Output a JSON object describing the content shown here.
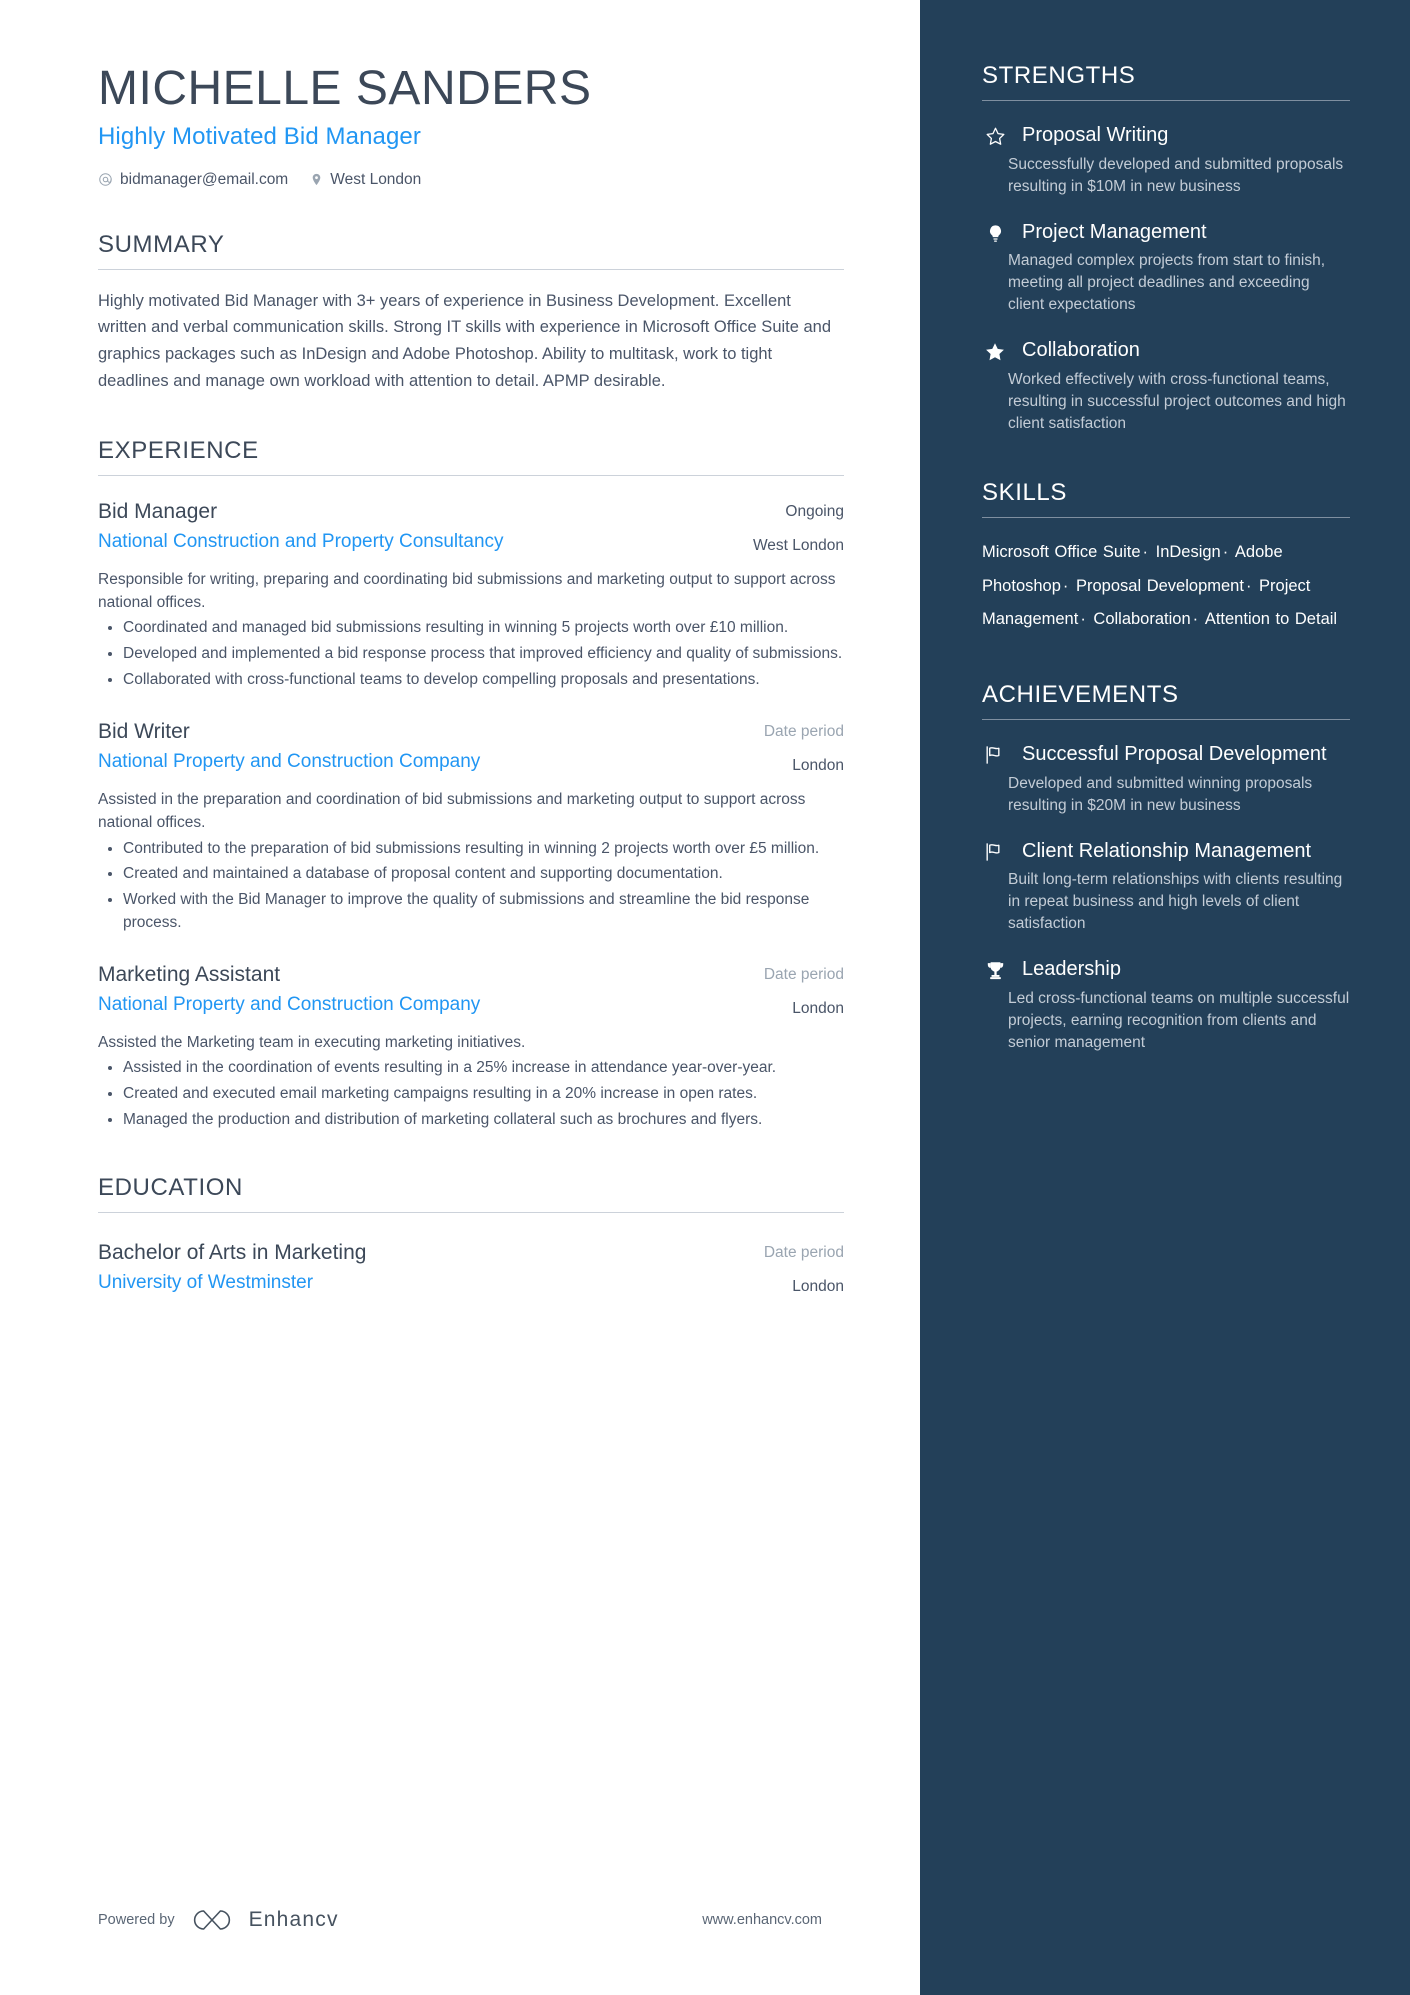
{
  "header": {
    "name": "MICHELLE SANDERS",
    "headline": "Highly Motivated Bid Manager",
    "email": "bidmanager@email.com",
    "location": "West London",
    "email_icon": "at-icon",
    "location_icon": "map-pin-icon"
  },
  "summary": {
    "title": "SUMMARY",
    "text": "Highly motivated Bid Manager with 3+ years of experience in Business Development. Excellent written and verbal communication skills. Strong IT skills with experience in Microsoft Office Suite and graphics packages such as InDesign and Adobe Photoshop. Ability to multitask, work to tight deadlines and manage own workload with attention to detail. APMP desirable."
  },
  "experience": {
    "title": "EXPERIENCE",
    "entries": [
      {
        "title": "Bid Manager",
        "org": "National Construction and Property Consultancy",
        "date": "Ongoing",
        "location": "West London",
        "description": "Responsible for writing, preparing and coordinating bid submissions and marketing output to support across national offices.",
        "bullets": [
          "Coordinated and managed bid submissions resulting in winning 5 projects worth over £10 million.",
          "Developed and implemented a bid response process that improved efficiency and quality of submissions.",
          "Collaborated with cross-functional teams to develop compelling proposals and presentations."
        ]
      },
      {
        "title": "Bid Writer",
        "org": "National Property and Construction Company",
        "date": "Date period",
        "location": "London",
        "description": "Assisted in the preparation and coordination of bid submissions and marketing output to support across national offices.",
        "bullets": [
          "Contributed to the preparation of bid submissions resulting in winning 2 projects worth over £5 million.",
          "Created and maintained a database of proposal content and supporting documentation.",
          "Worked with the Bid Manager to improve the quality of submissions and streamline the bid response process."
        ]
      },
      {
        "title": "Marketing Assistant",
        "org": "National Property and Construction Company",
        "date": "Date period",
        "location": "London",
        "description": "Assisted the Marketing team in executing marketing initiatives.",
        "bullets": [
          "Assisted in the coordination of events resulting in a 25% increase in attendance year-over-year.",
          "Created and executed email marketing campaigns resulting in a 20% increase in open rates.",
          "Managed the production and distribution of marketing collateral such as brochures and flyers."
        ]
      }
    ]
  },
  "education": {
    "title": "EDUCATION",
    "entries": [
      {
        "title": "Bachelor of Arts in Marketing",
        "org": "University of Westminster",
        "date": "Date period",
        "location": "London"
      }
    ]
  },
  "footer": {
    "powered_by": "Powered by",
    "brand": "Enhancv",
    "brand_icon": "enhancv-logo-icon",
    "website": "www.enhancv.com"
  },
  "strengths": {
    "title": "STRENGTHS",
    "items": [
      {
        "icon": "star-outline-icon",
        "title": "Proposal Writing",
        "desc": "Successfully developed and submitted proposals resulting in $10M in new business"
      },
      {
        "icon": "lightbulb-icon",
        "title": "Project Management",
        "desc": "Managed complex projects from start to finish, meeting all project deadlines and exceeding client expectations"
      },
      {
        "icon": "star-filled-icon",
        "title": "Collaboration",
        "desc": "Worked effectively with cross-functional teams, resulting in successful project outcomes and high client satisfaction"
      }
    ]
  },
  "skills": {
    "title": "SKILLS",
    "items": [
      "Microsoft Office Suite",
      "InDesign",
      "Adobe Photoshop",
      "Proposal Development",
      "Project Management",
      "Collaboration",
      "Attention to Detail"
    ],
    "separator": "·"
  },
  "achievements": {
    "title": "ACHIEVEMENTS",
    "items": [
      {
        "icon": "flag-icon",
        "title": "Successful Proposal Development",
        "desc": "Developed and submitted winning proposals resulting in $20M in new business"
      },
      {
        "icon": "flag-icon",
        "title": "Client Relationship Management",
        "desc": "Built long-term relationships with clients resulting in repeat business and high levels of client satisfaction"
      },
      {
        "icon": "trophy-icon",
        "title": "Leadership",
        "desc": "Led cross-functional teams on multiple successful projects, earning recognition from clients and senior management"
      }
    ]
  },
  "colors": {
    "accent_blue": "#2196f3",
    "sidebar_bg": "#234059",
    "heading": "#3c4858",
    "body_text": "#4a5568",
    "muted": "#9aa5b1"
  }
}
